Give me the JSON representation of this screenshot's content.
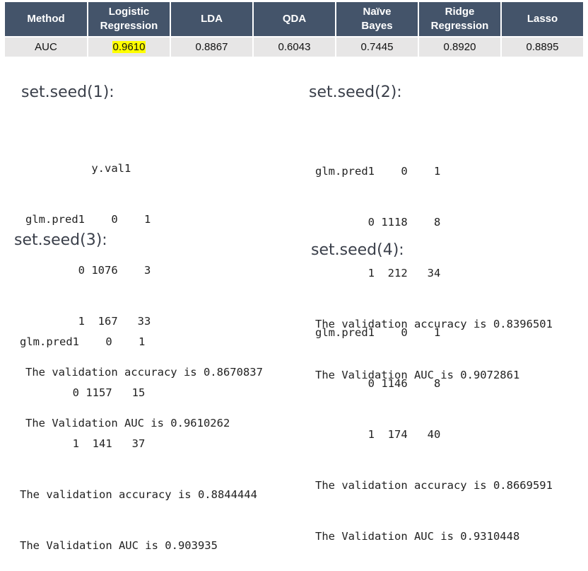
{
  "table": {
    "headers": [
      "Method",
      "Logistic\nRegression",
      "LDA",
      "QDA",
      "Naïve\nBayes",
      "Ridge\nRegression",
      "Lasso"
    ],
    "row_label": "AUC",
    "values": [
      "0.9610",
      "0.8867",
      "0.6043",
      "0.7445",
      "0.8920",
      "0.8895"
    ],
    "highlight_color": "#ffff00"
  },
  "seeds": [
    {
      "title": "set.seed(1):",
      "lines": [
        "          y.val1",
        "glm.pred1    0    1",
        "        0 1076    3",
        "        1  167   33",
        "The validation accuracy is 0.8670837",
        "The Validation AUC is 0.9610262"
      ]
    },
    {
      "title": "set.seed(2):",
      "lines": [
        "glm.pred1    0    1",
        "        0 1118    8",
        "        1  212   34",
        "The validation accuracy is 0.8396501",
        "The Validation AUC is 0.9072861"
      ]
    },
    {
      "title": "set.seed(3):",
      "lines": [
        "glm.pred1    0    1",
        "        0 1157   15",
        "        1  141   37",
        "The validation accuracy is 0.8844444",
        "The Validation AUC is 0.903935"
      ]
    },
    {
      "title": "set.seed(4):",
      "lines": [
        "glm.pred1    0    1",
        "        0 1146    8",
        "        1  174   40",
        "The validation accuracy is 0.8669591",
        "The Validation AUC is 0.9310448"
      ]
    }
  ]
}
